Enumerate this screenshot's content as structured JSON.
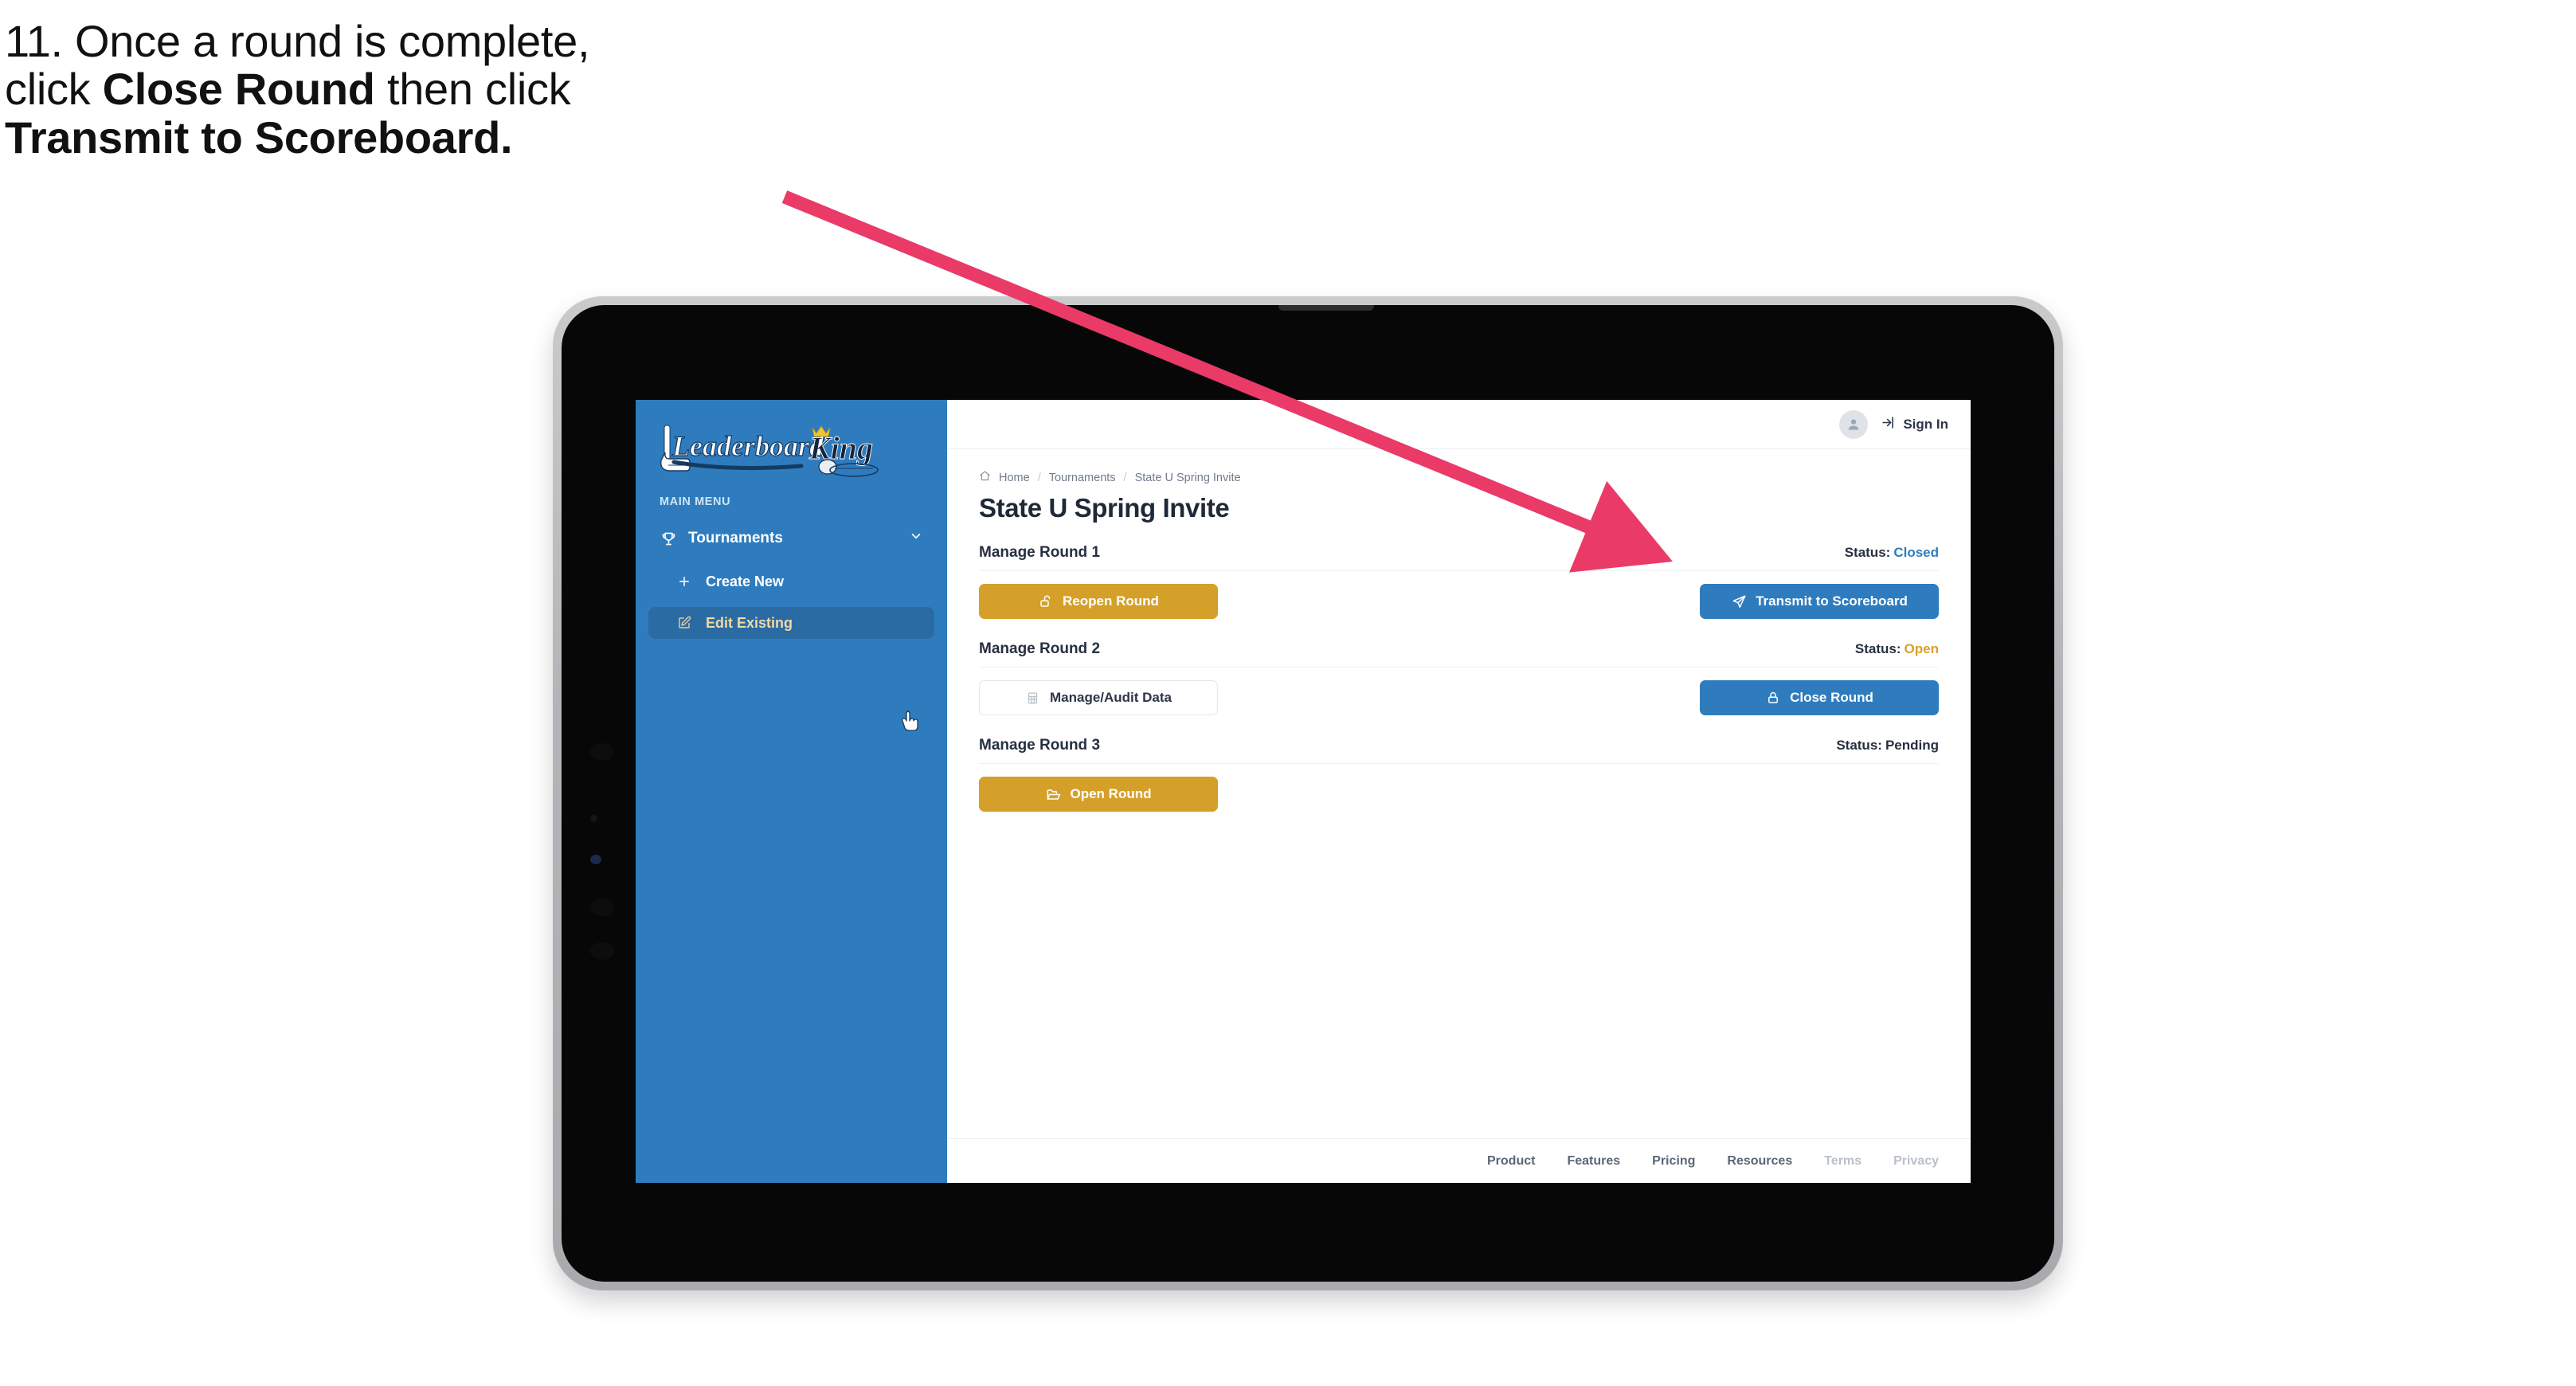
{
  "instruction": {
    "line1": "11. Once a round is complete,",
    "line2_a": "click ",
    "line2_b": "Close Round",
    "line2_c": " then click",
    "line3": "Transmit to Scoreboard."
  },
  "annotation": {
    "arrow_color": "#ea3a68",
    "arrow_from": "985,247",
    "arrow_to": "2100,705"
  },
  "app": {
    "brand": {
      "word1": "Leaderboard",
      "word2": "King",
      "logo_icon": "golf-club-and-ball-icon"
    },
    "sidebar": {
      "section_label": "MAIN MENU",
      "nav": {
        "label": "Tournaments",
        "icon": "trophy-icon",
        "chevron": "chevron-down-icon"
      },
      "sub_items": [
        {
          "label": "Create New",
          "icon": "plus-icon",
          "active": false
        },
        {
          "label": "Edit Existing",
          "icon": "pencil-edit-icon",
          "active": true
        }
      ],
      "bg_color": "#2E7CBE",
      "active_bg_color": "#2A6BA4",
      "active_text_color": "#F0D9A6"
    },
    "topbar": {
      "avatar_icon": "user-avatar-icon",
      "signin_icon": "login-arrow-icon",
      "signin_label": "Sign In"
    },
    "breadcrumb": {
      "home_icon": "home-icon",
      "items": [
        "Home",
        "Tournaments",
        "State U Spring Invite"
      ],
      "separator": "/"
    },
    "page_title": "State U Spring Invite",
    "status_label": "Status:",
    "rounds": [
      {
        "name": "Manage Round 1",
        "status_value": "Closed",
        "status_class": "closed",
        "left_button": {
          "label": "Reopen Round",
          "icon": "unlock-icon",
          "style": "gold"
        },
        "right_button": {
          "label": "Transmit to Scoreboard",
          "icon": "paper-plane-send-icon",
          "style": "blue"
        }
      },
      {
        "name": "Manage Round 2",
        "status_value": "Open",
        "status_class": "open",
        "left_button": {
          "label": "Manage/Audit Data",
          "icon": "table-grid-icon",
          "style": "ghost"
        },
        "right_button": {
          "label": "Close Round",
          "icon": "lock-icon",
          "style": "blue"
        }
      },
      {
        "name": "Manage Round 3",
        "status_value": "Pending",
        "status_class": "pending",
        "left_button": {
          "label": "Open Round",
          "icon": "open-folder-icon",
          "style": "gold"
        },
        "right_button": null
      }
    ],
    "footer_links": [
      {
        "label": "Product",
        "muted": false
      },
      {
        "label": "Features",
        "muted": false
      },
      {
        "label": "Pricing",
        "muted": false
      },
      {
        "label": "Resources",
        "muted": false
      },
      {
        "label": "Terms",
        "muted": true
      },
      {
        "label": "Privacy",
        "muted": true
      }
    ]
  }
}
